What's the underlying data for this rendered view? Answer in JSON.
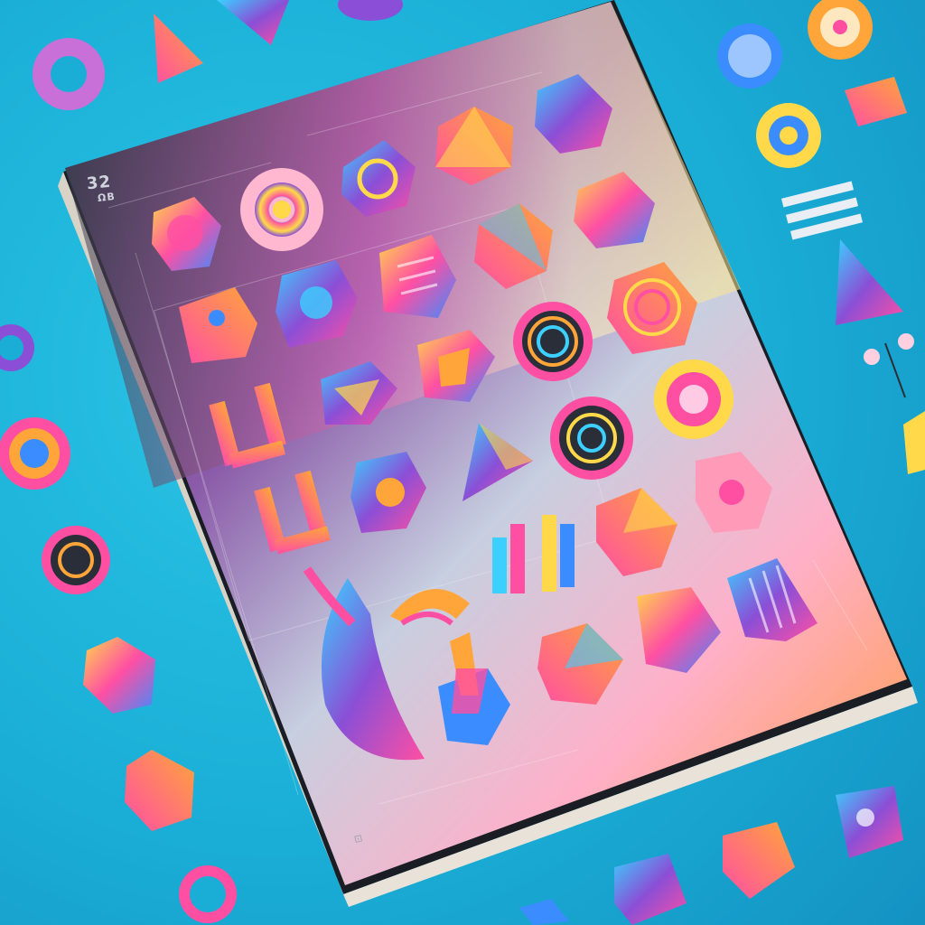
{
  "book": {
    "corner_number": "32",
    "corner_sub": "ΩΒ",
    "page_marker": "⊡"
  },
  "palette": {
    "cyan": "#1ab3dc",
    "pink": "#ff4fa3",
    "orange": "#ffa53a",
    "yellow": "#ffd94a",
    "purple": "#8a4fd6",
    "blue": "#3b8cff",
    "cover_dark": "#2f3440"
  }
}
